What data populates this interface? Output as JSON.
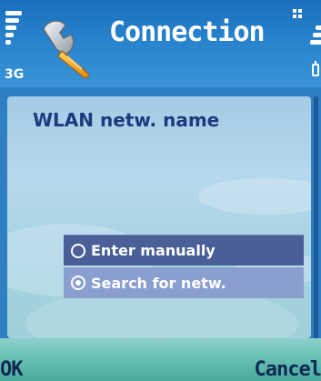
{
  "status": {
    "network_type": "3G",
    "signal_icon": "signal-strength-icon",
    "battery_icon": "battery-icon",
    "menu_icon": "menu-grid-icon"
  },
  "header": {
    "title": "Connection",
    "app_icon": "wrench-settings-icon"
  },
  "dialog": {
    "prompt": "WLAN netw. name",
    "options": [
      {
        "label": "Enter manually",
        "selected": false
      },
      {
        "label": "Search for netw.",
        "selected": true
      }
    ]
  },
  "softkeys": {
    "left": "OK",
    "right": "Cancel"
  },
  "colors": {
    "accent": "#2a86cf",
    "prompt_text": "#1c3a7d",
    "option_selected": "#8a9fd0",
    "option_unselected": "#4a5f97"
  }
}
